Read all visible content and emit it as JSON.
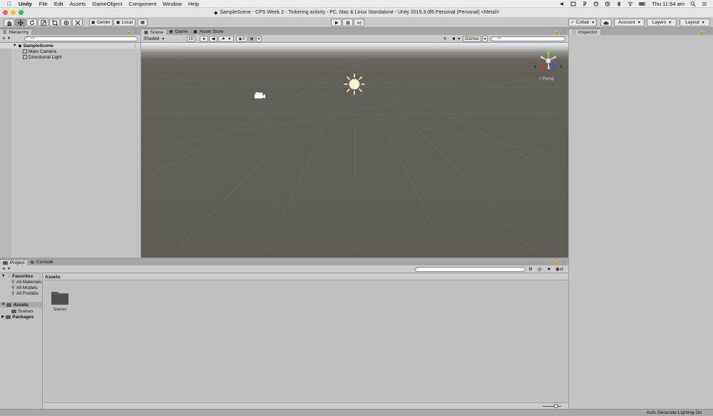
{
  "menubar": {
    "app": "Unity",
    "items": [
      "File",
      "Edit",
      "Assets",
      "GameObject",
      "Component",
      "Window",
      "Help"
    ],
    "clock": "Thu 11:54 am"
  },
  "window": {
    "title": "SampleScene - CPS Week 2 - Tinkering activity - PC, Mac & Linux Standalone - Unity 2019.3.0f6 Personal (Personal) <Metal>"
  },
  "toolbar": {
    "pivot": "Center",
    "space": "Local",
    "collab": "Collab",
    "account": "Account",
    "layers": "Layers",
    "layout": "Layout"
  },
  "hierarchy": {
    "tab": "Hierarchy",
    "add": "+",
    "search_placeholder": "All",
    "scene": "SampleScene",
    "objects": [
      "Main Camera",
      "Directional Light"
    ]
  },
  "scene": {
    "tabs": [
      "Scene",
      "Game",
      "Asset Store"
    ],
    "shading": "Shaded",
    "mode_2d": "2D",
    "hidden_count": "0",
    "gizmos": "Gizmos",
    "search_placeholder": "All",
    "persp": "Persp",
    "axis_x": "x",
    "axis_z": "z"
  },
  "inspector": {
    "tab": "Inspector"
  },
  "project": {
    "tabs": [
      "Project",
      "Console"
    ],
    "add": "+",
    "favorites_label": "Favorites",
    "favorites": [
      "All Materials",
      "All Models",
      "All Prefabs"
    ],
    "assets_label": "Assets",
    "asset_children": [
      "Scenes"
    ],
    "packages_label": "Packages",
    "breadcrumb": "Assets",
    "hidden_count": "10",
    "folder_items": [
      "Scenes"
    ]
  },
  "status": {
    "text": "Auto Generate Lighting On"
  },
  "colors": {
    "scene_ground": "#605c56",
    "sky": "#e8eef2",
    "panel": "#c2c2c2"
  }
}
